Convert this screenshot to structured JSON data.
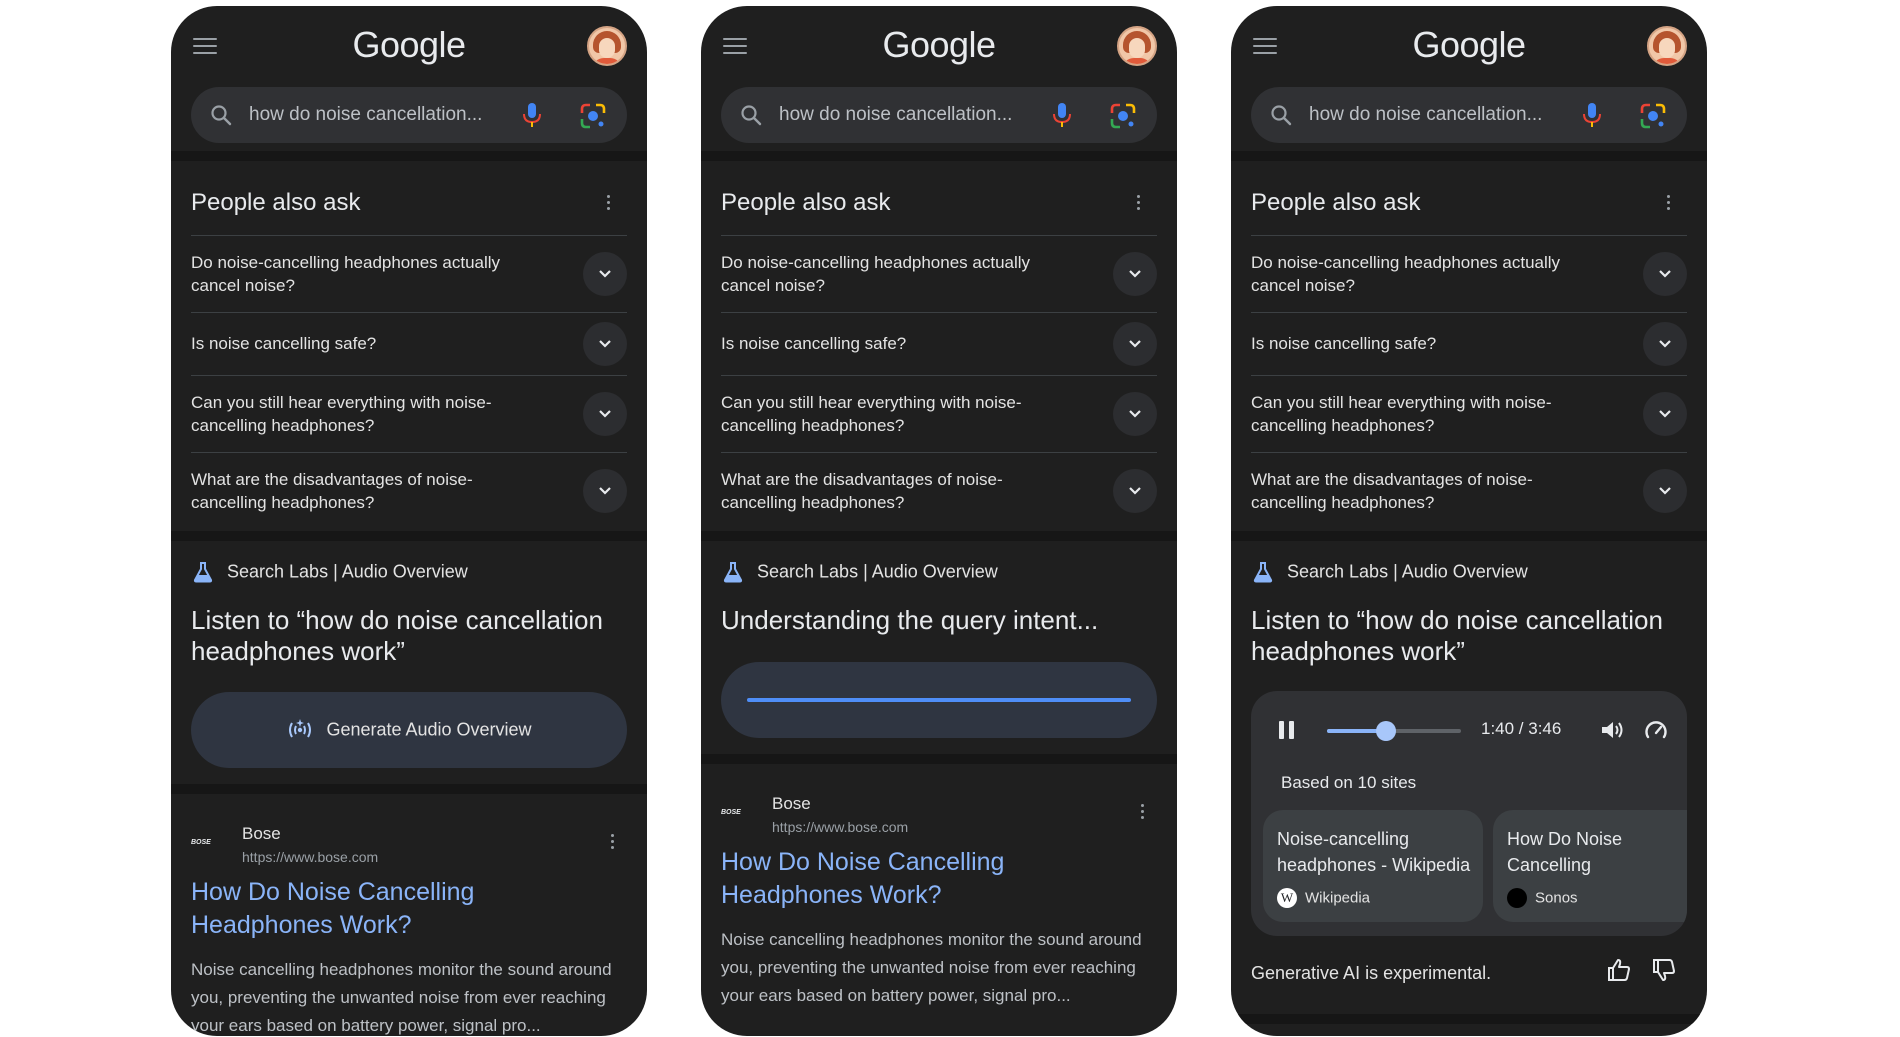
{
  "header": {
    "logo_text": "Google",
    "search_query": "how do noise cancellation...",
    "icons": [
      "menu-icon",
      "avatar",
      "search-icon",
      "mic-icon",
      "lens-icon"
    ]
  },
  "people_also_ask": {
    "title": "People also ask",
    "questions": [
      "Do noise-cancelling headphones actually cancel noise?",
      "Is noise cancelling safe?",
      "Can you still hear everything with noise-cancelling headphones?",
      "What are the disadvantages of noise-cancelling headphones?"
    ]
  },
  "labs": {
    "header": "Search Labs | Audio Overview",
    "listen_title": "Listen to “how do noise cancellation headphones work”",
    "generate_button": "Generate Audio Overview",
    "loading_title": "Understanding the query intent..."
  },
  "result": {
    "site_name": "Bose",
    "site_url": "https://www.bose.com",
    "site_logo_text": "BOSE",
    "title": "How Do Noise Cancelling Headphones Work?",
    "snippet": "Noise cancelling headphones monitor the sound around you, preventing the unwanted noise from ever reaching your ears based on battery power, signal pro..."
  },
  "player": {
    "time": "1:40 / 3:46",
    "progress_fraction": 0.442,
    "based_on": "Based on 10 sites",
    "sources": [
      {
        "title": "Noise-cancelling headphones - Wikipedia",
        "site": "Wikipedia",
        "site_color": "#ffffff"
      },
      {
        "title": "How Do Noise Cancelling Headphones Work",
        "site": "Sonos",
        "site_color": "#000000"
      }
    ]
  },
  "footer": {
    "disclaimer": "Generative AI is experimental."
  },
  "colors": {
    "background": "#1f1f1f",
    "link": "#8ab4f8",
    "progress": "#4f8ef7",
    "card": "#303134"
  }
}
